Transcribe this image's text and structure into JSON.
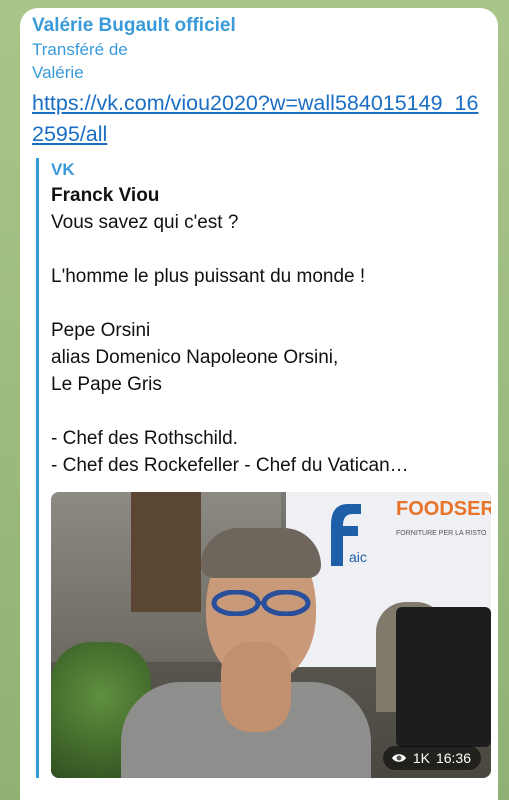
{
  "message": {
    "sender": "Valérie Bugault officiel",
    "forwarded_label": "Transféré de",
    "forwarded_from": "Valérie",
    "link": "https://vk.com/viou2020?w=wall584015149_162595/all"
  },
  "preview": {
    "site": "VK",
    "title": "Franck Viou",
    "description": "Vous savez qui c'est ?\n\nL'homme le plus puissant du monde !\n\nPepe Orsini\nalias Domenico Napoleone Orsini,\nLe Pape Gris\n\n- Chef des Rothschild.\n- Chef des Rockefeller - Chef du Vatican…",
    "truck_brand": "FOODSERV",
    "truck_sub": "FORNITURE PER LA RISTO",
    "video": {
      "views": "1K",
      "time": "16:36"
    }
  },
  "colors": {
    "accent": "#3a9ad9",
    "link": "#1a6fc4",
    "wallpaper": "#9ab97c"
  }
}
